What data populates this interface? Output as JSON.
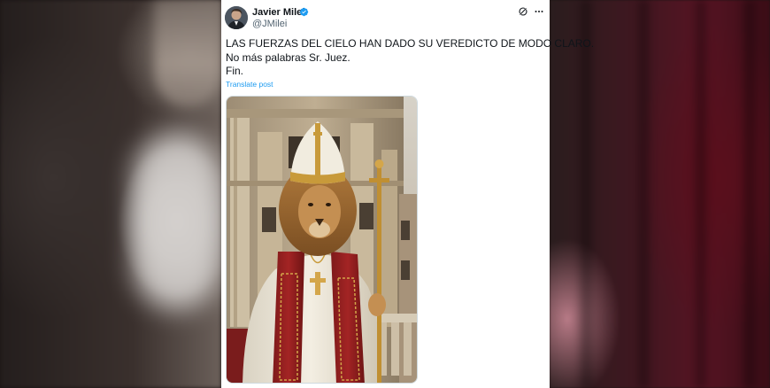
{
  "tweet": {
    "author_name": "Javier Milei",
    "author_handle": "@JMilei",
    "verified": true,
    "text_lines": [
      "LAS FUERZAS DEL CIELO HAN DADO SU VEREDICTO DE MODO CLARO.",
      "No más palabras Sr. Juez.",
      "Fin."
    ],
    "translate_label": "Translate post",
    "media_icon": "lion-pope-image"
  },
  "icons": {
    "verified": "verified-badge-icon",
    "grok": "grok-icon",
    "more": "more-options-icon"
  },
  "colors": {
    "link": "#1d9bf0",
    "verified": "#1d9bf0",
    "text": "#0f1419",
    "secondary": "#536471"
  }
}
